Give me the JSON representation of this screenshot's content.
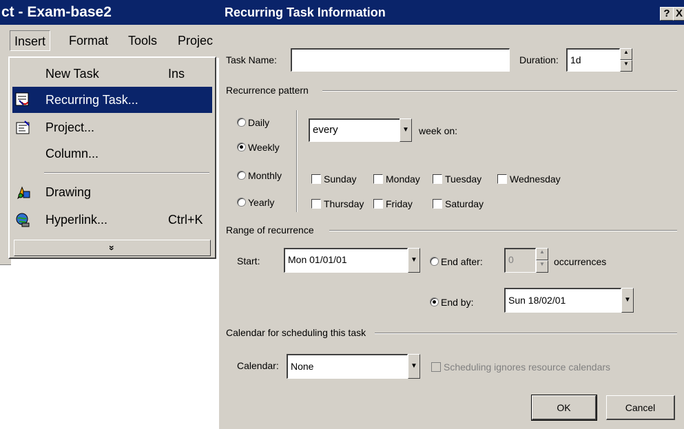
{
  "app": {
    "title": "ct - Exam-base2",
    "menubar": [
      "Insert",
      "Format",
      "Tools",
      "Projec"
    ]
  },
  "insert_menu": {
    "items": [
      {
        "label": "New Task",
        "shortcut": "Ins",
        "icon": "none"
      },
      {
        "label": "Recurring Task...",
        "shortcut": "",
        "icon": "recurring-task-icon",
        "selected": true
      },
      {
        "label": "Project...",
        "shortcut": "",
        "icon": "project-icon"
      },
      {
        "label": "Column...",
        "shortcut": "",
        "icon": "none"
      },
      {
        "label": "Drawing",
        "shortcut": "",
        "icon": "drawing-icon"
      },
      {
        "label": "Hyperlink...",
        "shortcut": "Ctrl+K",
        "icon": "hyperlink-icon"
      }
    ],
    "more_glyph": "»"
  },
  "dialog": {
    "title": "Recurring Task Information",
    "help_button": "?",
    "close_button": "X",
    "task_name": {
      "label": "Task Name:",
      "value": ""
    },
    "duration": {
      "label": "Duration:",
      "value": "1d"
    },
    "recurrence_pattern": {
      "group_label": "Recurrence pattern",
      "options": [
        "Daily",
        "Weekly",
        "Monthly",
        "Yearly"
      ],
      "selected": "Weekly",
      "frequency": {
        "value": "every",
        "suffix": "week on:"
      },
      "days": [
        "Sunday",
        "Monday",
        "Tuesday",
        "Wednesday",
        "Thursday",
        "Friday",
        "Saturday"
      ]
    },
    "range": {
      "group_label": "Range of recurrence",
      "start_label": "Start:",
      "start_value": "Mon 01/01/01",
      "end_after_label": "End after:",
      "occurrences_value": "0",
      "occurrences_label": "occurrences",
      "end_by_label": "End by:",
      "end_by_value": "Sun 18/02/01",
      "selected": "End by"
    },
    "calendar": {
      "group_label": "Calendar for scheduling this task",
      "label": "Calendar:",
      "value": "None",
      "ignore_label": "Scheduling ignores resource calendars"
    },
    "ok_label": "OK",
    "cancel_label": "Cancel"
  },
  "colors": {
    "titlebar": "#0a246a",
    "face": "#d4d0c8",
    "highlight": "#0a246a"
  }
}
